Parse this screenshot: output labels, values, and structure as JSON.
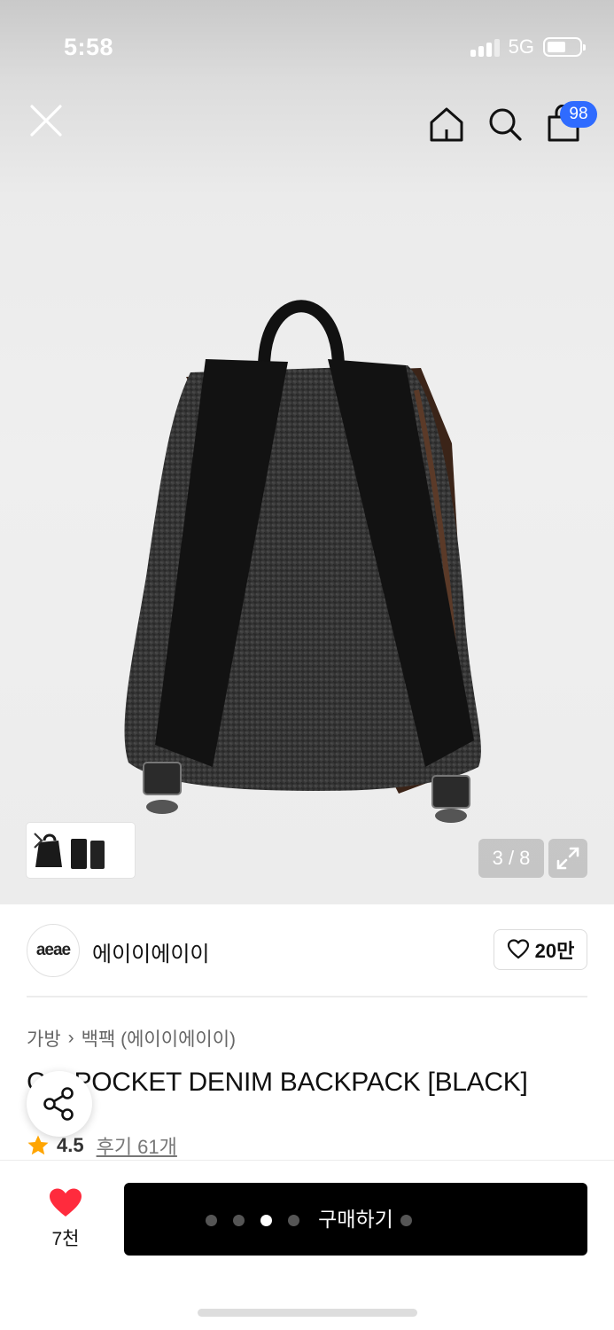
{
  "status_bar": {
    "time": "5:58",
    "network": "5G"
  },
  "header": {
    "cart_count": "98"
  },
  "icons": {
    "close": "close-icon",
    "home": "home-icon",
    "search": "search-icon",
    "bag": "shopping-bag-icon",
    "expand": "expand-icon",
    "heart": "heart-icon",
    "share": "share-icon",
    "star": "star-icon",
    "chevron": "chevron-right-icon"
  },
  "gallery": {
    "counter": "3 / 8",
    "current": 3,
    "total": 8
  },
  "brand": {
    "logo_text": "aeae",
    "name": "에이이에이이",
    "likes": "20만"
  },
  "breadcrumb": {
    "category": "가방",
    "separator": "›",
    "subcategory": "백팩 (에이이에이이)"
  },
  "product": {
    "title": "C... POCKET DENIM BACKPACK [BLACK]",
    "rating": "4.5",
    "reviews": "후기 61개"
  },
  "bottom_bar": {
    "wish_count": "7천",
    "buy_label": "구매하기",
    "page_dots": 5,
    "active_dot": 3
  },
  "colors": {
    "accent_badge": "#2f6bff",
    "heart": "#ff2b3d",
    "star": "#ffa500",
    "buy_button": "#000000"
  }
}
